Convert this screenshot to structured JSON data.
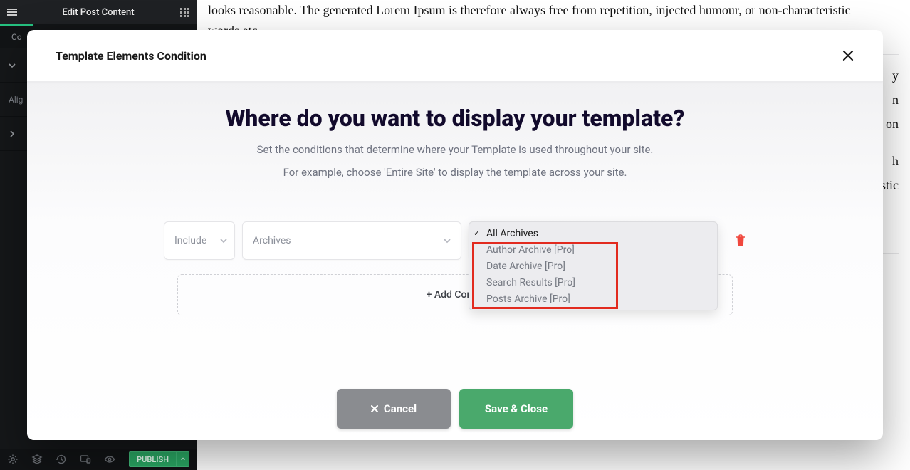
{
  "editor": {
    "topbar_title": "Edit Post Content",
    "sidebar_tab": "Co",
    "side_advanced": "Alig",
    "publish_label": "PUBLISH"
  },
  "page_bg": {
    "p1a": "looks reasonable. The generated Lorem Ipsum is therefore always free from repetition, injected humour, or non-characteristic",
    "p1b": "words etc.",
    "p2a": "y",
    "p2b": "n",
    "p2c": "s on",
    "p3a": "h",
    "p3b": "stic"
  },
  "modal": {
    "title": "Template Elements Condition",
    "headline": "Where do you want to display your template?",
    "sub1": "Set the conditions that determine where your Template is used throughout your site.",
    "sub2": "For example, choose 'Entire Site' to display the template across your site.",
    "include_label": "Include",
    "archives_label": "Archives",
    "add_label": "+ Add Condit",
    "cancel_label": "Cancel",
    "save_label": "Save & Close",
    "dropdown": [
      "All Archives",
      "Author Archive [Pro]",
      "Date Archive [Pro]",
      "Search Results [Pro]",
      "Posts Archive [Pro]"
    ]
  }
}
